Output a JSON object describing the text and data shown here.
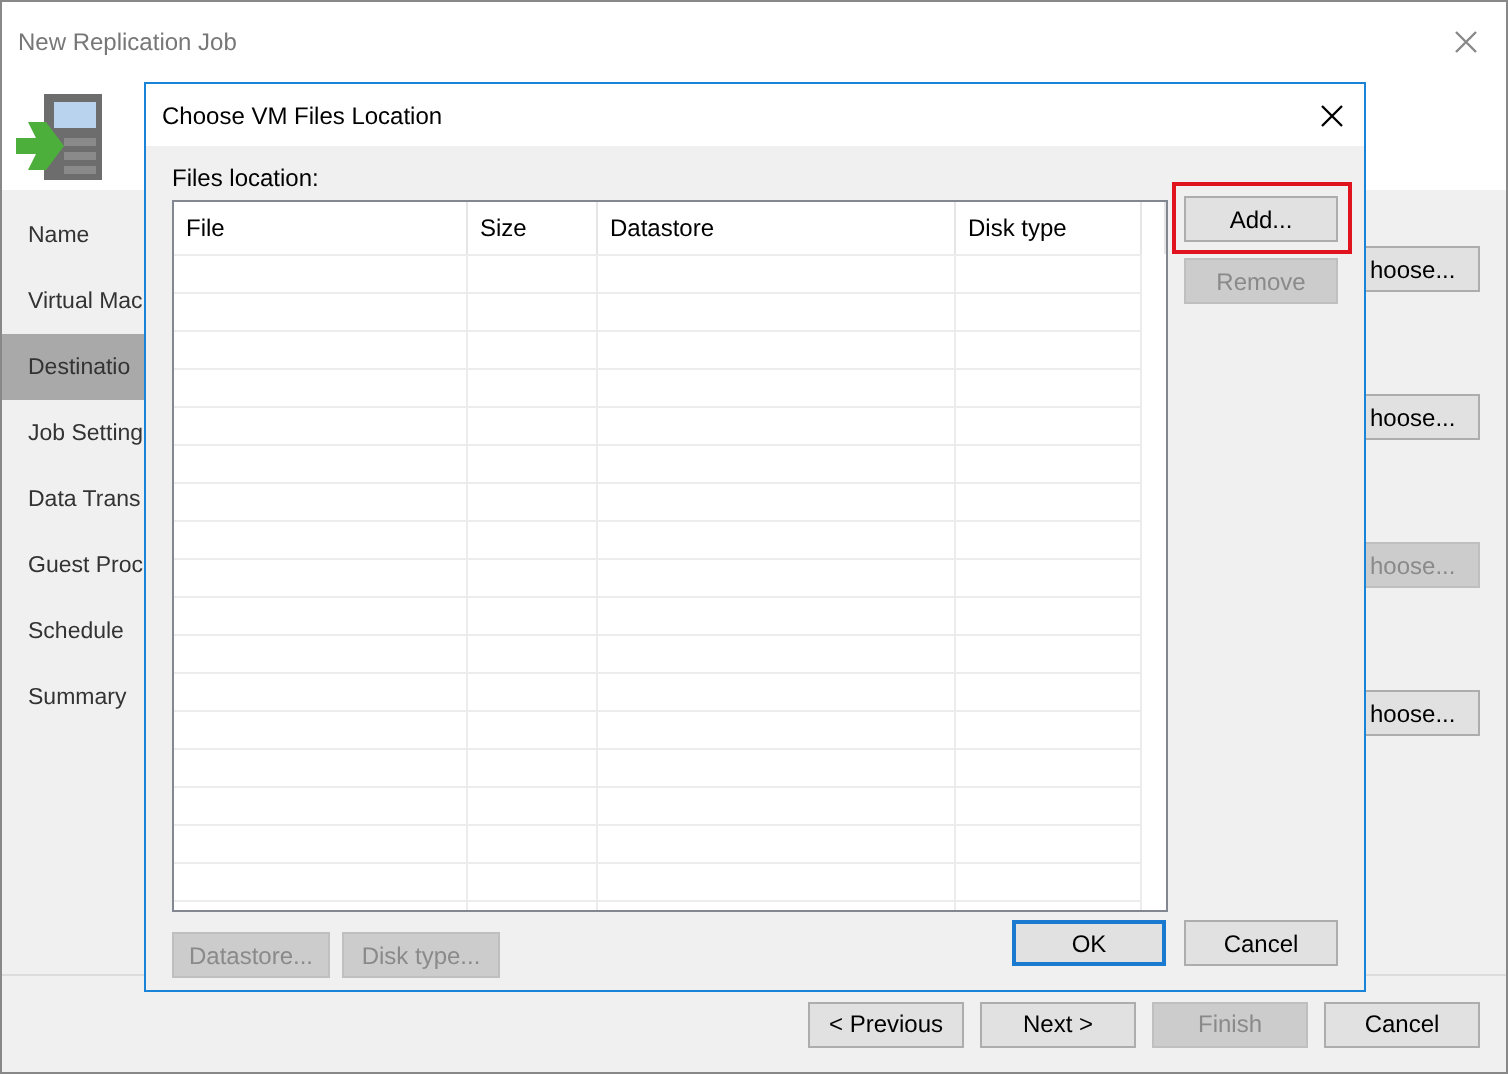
{
  "window": {
    "title": "New Replication Job"
  },
  "sidebar": {
    "items": [
      {
        "label": "Name",
        "selected": false
      },
      {
        "label": "Virtual Mac",
        "selected": false
      },
      {
        "label": "Destinatio",
        "selected": true
      },
      {
        "label": "Job Setting",
        "selected": false
      },
      {
        "label": "Data Trans",
        "selected": false
      },
      {
        "label": "Guest Proc",
        "selected": false
      },
      {
        "label": "Schedule",
        "selected": false
      },
      {
        "label": "Summary",
        "selected": false
      }
    ]
  },
  "choose_buttons": [
    {
      "label": "hoose...",
      "disabled": false
    },
    {
      "label": "hoose...",
      "disabled": false
    },
    {
      "label": "hoose...",
      "disabled": true
    },
    {
      "label": "hoose...",
      "disabled": false
    }
  ],
  "footer": {
    "buttons": [
      {
        "label": "< Previous",
        "disabled": false
      },
      {
        "label": "Next >",
        "disabled": false
      },
      {
        "label": "Finish",
        "disabled": true
      },
      {
        "label": "Cancel",
        "disabled": false
      }
    ]
  },
  "dialog": {
    "title": "Choose VM Files Location",
    "files_label": "Files location:",
    "table": {
      "columns": [
        "File",
        "Size",
        "Datastore",
        "Disk type"
      ]
    },
    "side_buttons": [
      {
        "label": "Add...",
        "disabled": false,
        "highlighted": true
      },
      {
        "label": "Remove",
        "disabled": true,
        "highlighted": false
      }
    ],
    "bottom_buttons": [
      {
        "label": "Datastore...",
        "disabled": true
      },
      {
        "label": "Disk type...",
        "disabled": true
      }
    ],
    "buttons": [
      {
        "label": "OK",
        "default": true
      },
      {
        "label": "Cancel",
        "default": false
      }
    ]
  }
}
